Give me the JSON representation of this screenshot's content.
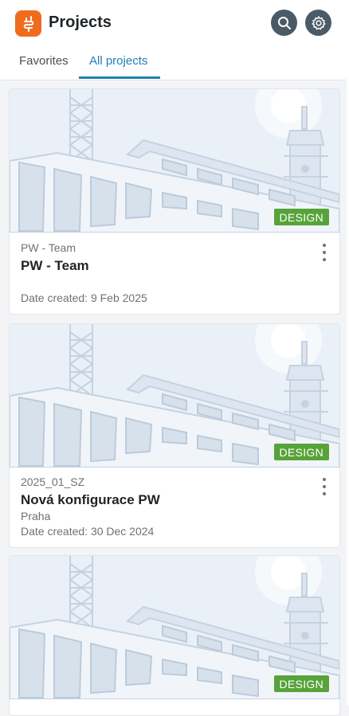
{
  "header": {
    "title": "Projects",
    "logo_icon": "app-logo-icon",
    "search_icon": "search-icon",
    "settings_icon": "gear-icon"
  },
  "tabs": [
    {
      "label": "Favorites",
      "active": false
    },
    {
      "label": "All projects",
      "active": true
    }
  ],
  "colors": {
    "accent": "#1f7fb3",
    "badge": "#57a33a",
    "logo": "#ef6c1f"
  },
  "projects": [
    {
      "code": "PW - Team",
      "name": "PW - Team",
      "location": "",
      "date": "Date created: 9 Feb 2025",
      "badge": "DESIGN"
    },
    {
      "code": "2025_01_SZ",
      "name": "Nová konfigurace PW",
      "location": "Praha",
      "date": "Date created: 30 Dec 2024",
      "badge": "DESIGN"
    },
    {
      "code": "",
      "name": "",
      "location": "",
      "date": "",
      "badge": "DESIGN"
    }
  ]
}
